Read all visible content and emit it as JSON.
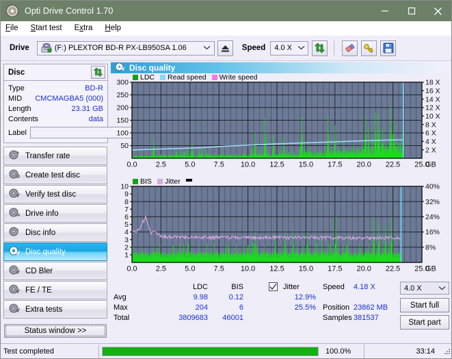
{
  "window": {
    "title": "Opti Drive Control 1.70",
    "icon": "disc-icon",
    "minimize": "minimize-icon",
    "maximize": "maximize-icon",
    "close": "close-icon"
  },
  "menu": [
    {
      "label": "File",
      "accel": "F"
    },
    {
      "label": "Start test",
      "accel": "S"
    },
    {
      "label": "Extra",
      "accel": "x"
    },
    {
      "label": "Help",
      "accel": "H"
    }
  ],
  "drivebar": {
    "drive_label": "Drive",
    "drive_value": "(F:)   PLEXTOR BD-R  PX-LB950SA 1.06",
    "eject": "eject-icon",
    "speed_label": "Speed",
    "speed_value": "4.0 X",
    "refresh": "refresh-icon",
    "eraser": "eraser-icon",
    "key": "key-icon",
    "save": "save-icon"
  },
  "disc_panel": {
    "title": "Disc",
    "refresh": "refresh-icon",
    "rows": [
      {
        "key": "Type",
        "value": "BD-R"
      },
      {
        "key": "MID",
        "value": "CMCMAGBA5 (000)"
      },
      {
        "key": "Length",
        "value": "23.31 GB"
      },
      {
        "key": "Contents",
        "value": "data"
      }
    ],
    "label_key": "Label",
    "label_value": "",
    "label_placeholder": ""
  },
  "sidebar": {
    "items": [
      {
        "label": "Transfer rate",
        "active": false
      },
      {
        "label": "Create test disc",
        "active": false
      },
      {
        "label": "Verify test disc",
        "active": false
      },
      {
        "label": "Drive info",
        "active": false
      },
      {
        "label": "Disc info",
        "active": false
      },
      {
        "label": "Disc quality",
        "active": true
      },
      {
        "label": "CD Bler",
        "active": false
      },
      {
        "label": "FE / TE",
        "active": false
      },
      {
        "label": "Extra tests",
        "active": false
      }
    ],
    "status_window": "Status window >>"
  },
  "main": {
    "header_title": "Disc quality",
    "header_icon": "disc-quality-icon"
  },
  "chart_data": [
    {
      "type": "area",
      "name": "top-chart",
      "title": "",
      "xlabel": "GB",
      "ylabel": "",
      "xlim": [
        0.0,
        25.0
      ],
      "xticks": [
        "0.0",
        "2.5",
        "5.0",
        "7.5",
        "10.0",
        "12.5",
        "15.0",
        "17.5",
        "20.0",
        "22.5",
        "25.0"
      ],
      "x_unit": "GB",
      "ylim": [
        0,
        300
      ],
      "yticks": [
        "50",
        "100",
        "150",
        "200",
        "250",
        "300"
      ],
      "y2lim": [
        0,
        18
      ],
      "y2ticks": [
        "2 X",
        "4 X",
        "6 X",
        "8 X",
        "10 X",
        "12 X",
        "14 X",
        "16 X",
        "18 X"
      ],
      "grid": true,
      "legend_position": "top-left",
      "legend": [
        {
          "name": "LDC",
          "color": "#18a018"
        },
        {
          "name": "Read speed",
          "color": "#84d8f8"
        },
        {
          "name": "Write speed",
          "color": "#f878e8"
        }
      ],
      "plot_bg": "#6c7a96",
      "data_end_gb": 23.4,
      "series": [
        {
          "name": "LDC",
          "type": "area",
          "color": "#18e018",
          "baseline": [
            8,
            9,
            10,
            10,
            11,
            12,
            12,
            11,
            10,
            11,
            12,
            13,
            13,
            12,
            12,
            13,
            14,
            14,
            15,
            15,
            16,
            17,
            18,
            19,
            20,
            21,
            22,
            24,
            26,
            28,
            30,
            33,
            36,
            38,
            40,
            42,
            44,
            46,
            48,
            50
          ],
          "spikes": [
            {
              "gb": 1.9,
              "value": 82
            },
            {
              "gb": 5.2,
              "value": 56
            },
            {
              "gb": 6.0,
              "value": 40
            },
            {
              "gb": 10.6,
              "value": 104
            },
            {
              "gb": 11.5,
              "value": 158
            },
            {
              "gb": 12.2,
              "value": 90
            },
            {
              "gb": 13.1,
              "value": 84
            },
            {
              "gb": 14.6,
              "value": 163
            },
            {
              "gb": 14.9,
              "value": 60
            },
            {
              "gb": 16.9,
              "value": 167
            },
            {
              "gb": 17.5,
              "value": 130
            },
            {
              "gb": 18.3,
              "value": 70
            },
            {
              "gb": 20.1,
              "value": 172
            },
            {
              "gb": 20.4,
              "value": 120
            },
            {
              "gb": 21.0,
              "value": 180
            },
            {
              "gb": 21.2,
              "value": 178
            },
            {
              "gb": 21.6,
              "value": 120
            },
            {
              "gb": 22.3,
              "value": 205
            },
            {
              "gb": 22.6,
              "value": 150
            }
          ]
        },
        {
          "name": "Read speed",
          "type": "line",
          "color": "#9fdcf8",
          "points": [
            {
              "gb": 0.0,
              "x_speed": 1.95
            },
            {
              "gb": 2.0,
              "x_speed": 2.15
            },
            {
              "gb": 4.0,
              "x_speed": 2.3
            },
            {
              "gb": 6.0,
              "x_speed": 2.5
            },
            {
              "gb": 8.0,
              "x_speed": 2.85
            },
            {
              "gb": 10.0,
              "x_speed": 3.1
            },
            {
              "gb": 12.0,
              "x_speed": 3.35
            },
            {
              "gb": 14.0,
              "x_speed": 3.55
            },
            {
              "gb": 16.0,
              "x_speed": 3.75
            },
            {
              "gb": 18.0,
              "x_speed": 3.95
            },
            {
              "gb": 20.0,
              "x_speed": 4.15
            },
            {
              "gb": 22.0,
              "x_speed": 4.3
            },
            {
              "gb": 23.4,
              "x_speed": 4.35
            }
          ],
          "end_marker_gb": 23.4
        }
      ]
    },
    {
      "type": "area",
      "name": "bottom-chart",
      "title": "",
      "xlabel": "GB",
      "xlim": [
        0.0,
        25.0
      ],
      "xticks": [
        "0.0",
        "2.5",
        "5.0",
        "7.5",
        "10.0",
        "12.5",
        "15.0",
        "17.5",
        "20.0",
        "22.5",
        "25.0"
      ],
      "x_unit": "GB",
      "ylim": [
        0,
        10
      ],
      "yticks": [
        "1",
        "2",
        "3",
        "4",
        "5",
        "6",
        "7",
        "8",
        "9",
        "10"
      ],
      "y2lim": [
        0,
        40
      ],
      "y2ticks": [
        "8%",
        "16%",
        "24%",
        "32%",
        "40%"
      ],
      "grid": true,
      "legend_position": "top-left",
      "legend": [
        {
          "name": "BIS",
          "color": "#18a018"
        },
        {
          "name": "Jitter",
          "color": "#d8a8e0"
        }
      ],
      "plot_bg": "#6c7a96",
      "data_end_gb": 23.2,
      "series": [
        {
          "name": "BIS",
          "type": "area",
          "color": "#18e018",
          "baseline_value": 1.1,
          "spikes": [
            {
              "gb": 10.6,
              "value": 4.0
            },
            {
              "gb": 12.4,
              "value": 3.7
            },
            {
              "gb": 13.2,
              "value": 4.0
            },
            {
              "gb": 13.9,
              "value": 4.1
            },
            {
              "gb": 15.1,
              "value": 4.0
            },
            {
              "gb": 16.4,
              "value": 3.3
            },
            {
              "gb": 17.6,
              "value": 6.0
            },
            {
              "gb": 18.6,
              "value": 3.6
            },
            {
              "gb": 20.9,
              "value": 6.0
            },
            {
              "gb": 21.3,
              "value": 5.1
            },
            {
              "gb": 21.9,
              "value": 4.8
            },
            {
              "gb": 22.4,
              "value": 6.0
            }
          ]
        },
        {
          "name": "Jitter",
          "type": "line",
          "color": "#d8a8e0",
          "points": [
            {
              "gb": 0.0,
              "pct": 16.0
            },
            {
              "gb": 0.6,
              "pct": 17.0
            },
            {
              "gb": 1.2,
              "pct": 24.5
            },
            {
              "gb": 1.6,
              "pct": 15.0
            },
            {
              "gb": 2.0,
              "pct": 16.0
            },
            {
              "gb": 2.6,
              "pct": 13.5
            },
            {
              "gb": 5.0,
              "pct": 13.2
            },
            {
              "gb": 10.0,
              "pct": 13.0
            },
            {
              "gb": 15.0,
              "pct": 13.1
            },
            {
              "gb": 20.0,
              "pct": 12.8
            },
            {
              "gb": 23.2,
              "pct": 13.0
            }
          ]
        }
      ]
    }
  ],
  "stats": {
    "hdr_ldc": "LDC",
    "hdr_bis": "BIS",
    "jitter_label": "Jitter",
    "jitter_checked": true,
    "rows": {
      "avg_label": "Avg",
      "max_label": "Max",
      "total_label": "Total",
      "ldc_avg": "9.98",
      "ldc_max": "204",
      "ldc_total": "3809683",
      "bis_avg": "0.12",
      "bis_max": "6",
      "bis_total": "46001",
      "jitter_avg": "12.9%",
      "jitter_max": "25.5%"
    },
    "speed_label": "Speed",
    "speed_value": "4.18 X",
    "position_label": "Position",
    "position_value": "23862 MB",
    "samples_label": "Samples",
    "samples_value": "381537",
    "speed_select": "4.0 X",
    "start_full": "Start full",
    "start_part": "Start part"
  },
  "statusbar": {
    "text": "Test completed",
    "progress_pct": "100.0%",
    "progress_value": 100,
    "time": "33:14"
  },
  "colors": {
    "titlebar": "#6d8068",
    "accent_blue": "#1a2fd0",
    "plot_bg": "#6c7a96",
    "ldc_green": "#18e018",
    "read_speed": "#9fdcf8",
    "jitter_pink": "#d8a8e0",
    "progress_green": "#14b014"
  }
}
